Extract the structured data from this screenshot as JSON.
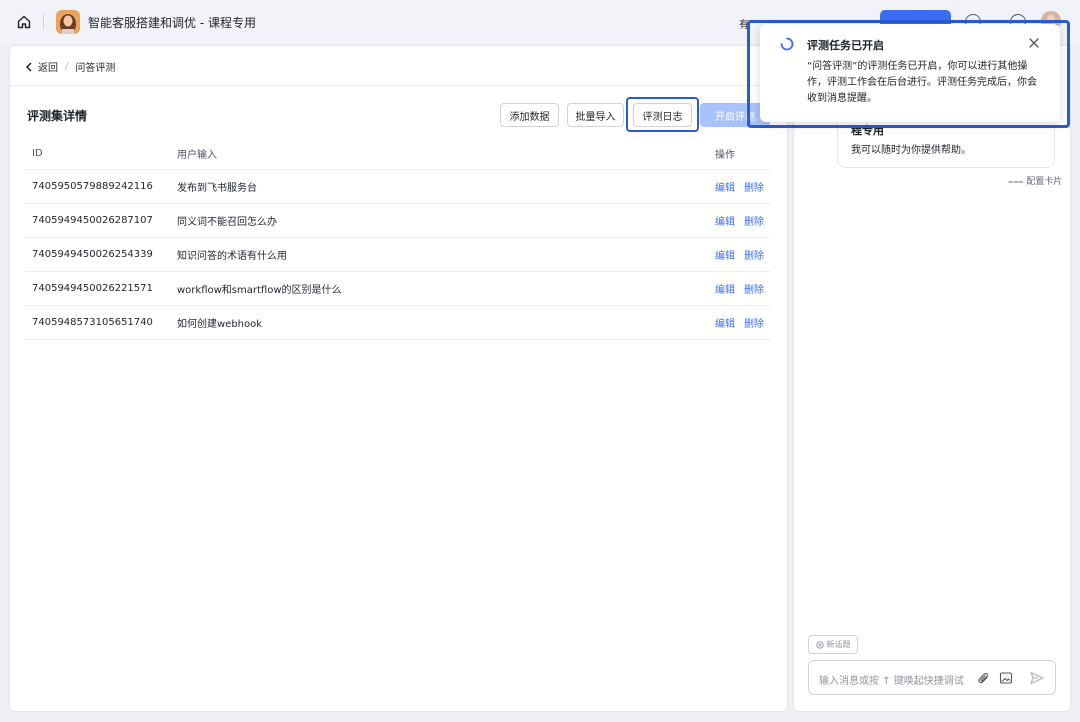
{
  "topbar": {
    "app_title": "智能客服搭建和调优 - 课程专用",
    "right_partial_text": "有"
  },
  "breadcrumb": {
    "back": "返回",
    "separator": "/",
    "current": "问答评测"
  },
  "section": {
    "title": "评测集详情"
  },
  "actions": {
    "add_data": "添加数据",
    "batch_import": "批量导入",
    "eval_log": "评测日志",
    "start_eval": "开启评测"
  },
  "table": {
    "headers": [
      "ID",
      "用户输入",
      "操作"
    ],
    "edit_label": "编辑",
    "delete_label": "删除",
    "rows": [
      {
        "id": "7405950579889242116",
        "input": "发布到飞书服务台"
      },
      {
        "id": "7405949450026287107",
        "input": "同义词不能召回怎么办"
      },
      {
        "id": "7405949450026254339",
        "input": "知识问答的术语有什么用"
      },
      {
        "id": "7405949450026221571",
        "input": "workflow和smartflow的区别是什么"
      },
      {
        "id": "7405948573105651740",
        "input": "如何创建webhook"
      }
    ]
  },
  "side": {
    "bubble_title": "程专用",
    "bubble_text": "我可以随时为你提供帮助。",
    "config_card": "配置卡片",
    "new_topic": "新话题",
    "input_placeholder": "输入消息或按 ↑ 键唤起快捷调试"
  },
  "toast": {
    "title": "评测任务已开启",
    "body": "“问答评测”的评测任务已开启，你可以进行其他操作，评测工作会在后台进行。评测任务完成后，你会收到消息提醒。"
  },
  "colors": {
    "accent": "#3b6ef5",
    "highlight": "#2a5bd7",
    "disabled_button": "#a8c3fa"
  }
}
